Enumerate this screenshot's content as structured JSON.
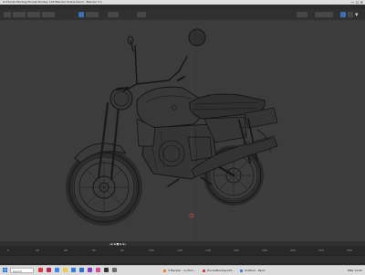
{
  "window": {
    "title": "G:/Honda Monkey/Honda Monkey 125 Blender Scene.blend - Blender 3.x",
    "controls": "— ☐ ✕"
  },
  "menubar": [
    "File",
    "Edit",
    "Render",
    "Window",
    "Help",
    "Layout",
    "Modeling",
    "Sculpting",
    "UV Editing",
    "Texture Paint",
    "Shading",
    "Animation",
    "Rendering",
    "Compositing"
  ],
  "timeline": {
    "ticks": [
      "0",
      "20",
      "40",
      "60",
      "80",
      "100",
      "120",
      "140",
      "160",
      "180",
      "200",
      "220",
      "240"
    ],
    "play_controls": "|◀ ◀ ■ ▶ ▶|"
  },
  "taskbar": {
    "search_placeholder": "Search",
    "apps": [
      {
        "label": "Honda Monkey",
        "color": "#d83b3b"
      },
      {
        "label": "Adobe",
        "color": "#c2245a"
      },
      {
        "label": "Chrome",
        "color": "#4285f4"
      },
      {
        "label": "Files",
        "color": "#f2c84b"
      },
      {
        "label": "Store",
        "color": "#2f7ed8"
      },
      {
        "label": "Mail",
        "color": "#2a6fd1"
      },
      {
        "label": "Photos",
        "color": "#7b3fc9"
      },
      {
        "label": "Media",
        "color": "#d84b9b"
      },
      {
        "label": "Terminal",
        "color": "#333333"
      },
      {
        "label": "Settings",
        "color": "#6b6b6b"
      }
    ],
    "running": [
      {
        "label": "3 Blender - G:/Hon...",
        "color": "#f07d1a"
      },
      {
        "label": "HondaMonkey125...",
        "color": "#c73a3a"
      },
      {
        "label": "Untitled - Paint",
        "color": "#3a7dc7"
      }
    ],
    "tray": "ENG 12:00"
  },
  "colors": {
    "viewport_bg": "#3c3c3c",
    "wire": "#141414",
    "accent": "#3d6fae"
  }
}
